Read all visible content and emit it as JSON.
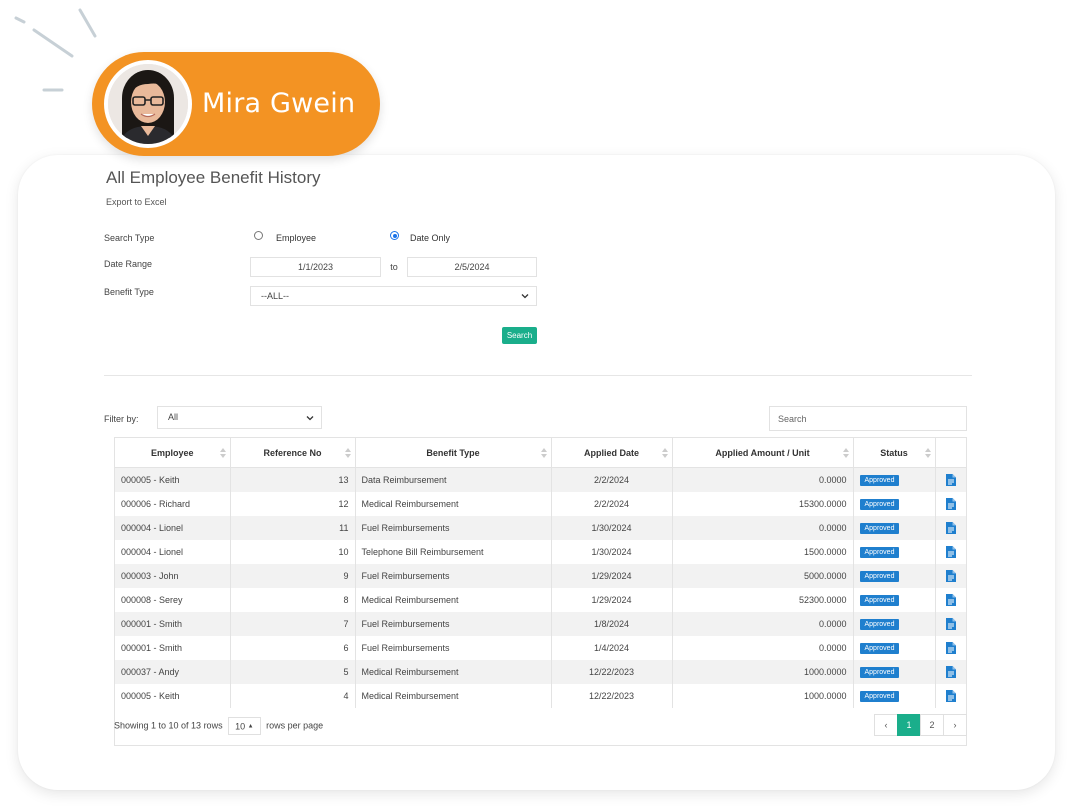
{
  "profile": {
    "name": "Mira Gwein"
  },
  "page": {
    "title": "All Employee Benefit History",
    "export_link": "Export to Excel"
  },
  "form": {
    "search_type_label": "Search Type",
    "search_type_options": [
      {
        "label": "Employee",
        "checked": false
      },
      {
        "label": "Date Only",
        "checked": true
      }
    ],
    "date_range_label": "Date Range",
    "date_from": "1/1/2023",
    "date_to_label": "to",
    "date_to": "2/5/2024",
    "benefit_type_label": "Benefit Type",
    "benefit_type_value": "--ALL--",
    "search_button": "Search"
  },
  "toolbar": {
    "filter_label": "Filter by:",
    "filter_value": "All",
    "search_placeholder": "Search"
  },
  "table": {
    "columns": [
      "Employee",
      "Reference No",
      "Benefit Type",
      "Applied Date",
      "Applied Amount / Unit",
      "Status",
      ""
    ],
    "rows": [
      {
        "employee": "000005 - Keith",
        "ref": "13",
        "type": "Data Reimbursement",
        "date": "2/2/2024",
        "amount": "0.0000",
        "status": "Approved"
      },
      {
        "employee": "000006 - Richard",
        "ref": "12",
        "type": "Medical Reimbursement",
        "date": "2/2/2024",
        "amount": "15300.0000",
        "status": "Approved"
      },
      {
        "employee": "000004 - Lionel",
        "ref": "11",
        "type": "Fuel Reimbursements",
        "date": "1/30/2024",
        "amount": "0.0000",
        "status": "Approved"
      },
      {
        "employee": "000004 - Lionel",
        "ref": "10",
        "type": "Telephone Bill Reimbursement",
        "date": "1/30/2024",
        "amount": "1500.0000",
        "status": "Approved"
      },
      {
        "employee": "000003 - John",
        "ref": "9",
        "type": "Fuel Reimbursements",
        "date": "1/29/2024",
        "amount": "5000.0000",
        "status": "Approved"
      },
      {
        "employee": "000008 - Serey",
        "ref": "8",
        "type": "Medical Reimbursement",
        "date": "1/29/2024",
        "amount": "52300.0000",
        "status": "Approved"
      },
      {
        "employee": "000001 - Smith",
        "ref": "7",
        "type": "Fuel Reimbursements",
        "date": "1/8/2024",
        "amount": "0.0000",
        "status": "Approved"
      },
      {
        "employee": "000001 - Smith",
        "ref": "6",
        "type": "Fuel Reimbursements",
        "date": "1/4/2024",
        "amount": "0.0000",
        "status": "Approved"
      },
      {
        "employee": "000037 - Andy",
        "ref": "5",
        "type": "Medical Reimbursement",
        "date": "12/22/2023",
        "amount": "1000.0000",
        "status": "Approved"
      },
      {
        "employee": "000005 - Keith",
        "ref": "4",
        "type": "Medical Reimbursement",
        "date": "12/22/2023",
        "amount": "1000.0000",
        "status": "Approved"
      }
    ]
  },
  "footer": {
    "showing_text": "Showing 1 to 10 of 13 rows",
    "page_size": "10",
    "rows_per_page_text": "rows per page",
    "pages": [
      "‹",
      "1",
      "2",
      "›"
    ],
    "active_page": "1"
  },
  "colors": {
    "brand_orange": "#f39323",
    "accent_green": "#1aae8b",
    "status_blue": "#1f7fce"
  }
}
